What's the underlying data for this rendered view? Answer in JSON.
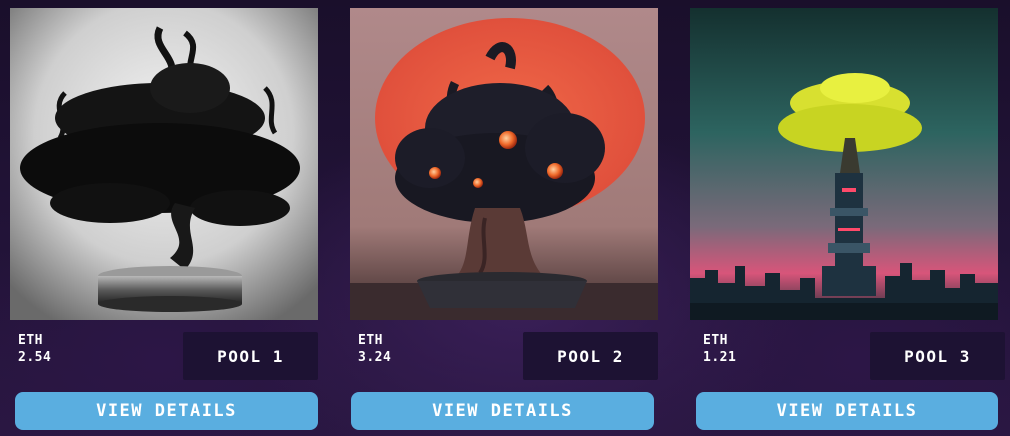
{
  "pools": [
    {
      "currency": "ETH",
      "amount": "2.54",
      "pool_label": "POOL 1",
      "button_label": "VIEW DETAILS",
      "image_subject": "monochrome horned bonsai tree"
    },
    {
      "currency": "ETH",
      "amount": "3.24",
      "pool_label": "POOL 2",
      "button_label": "VIEW DETAILS",
      "image_subject": "dark bonsai monster with glowing orange eyes on red backdrop"
    },
    {
      "currency": "ETH",
      "amount": "1.21",
      "pool_label": "POOL 3",
      "button_label": "VIEW DETAILS",
      "image_subject": "yellow tree atop cyberpunk tower over city skyline"
    }
  ],
  "colors": {
    "background": "#1f1233",
    "pool_box": "#1d1233",
    "button": "#5aaee0",
    "text": "#ffffff"
  }
}
